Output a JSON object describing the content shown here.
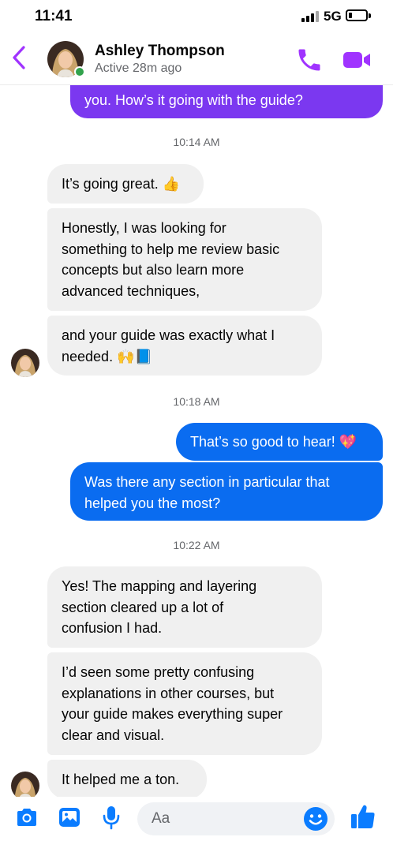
{
  "status_bar": {
    "time": "11:41",
    "network": "5G",
    "battery_level": 0.2
  },
  "header": {
    "contact_name": "Ashley Thompson",
    "contact_status": "Active 28m ago",
    "online": true,
    "back_icon": "chevron-left-icon",
    "call_icon": "phone-icon",
    "video_icon": "video-camera-icon"
  },
  "colors": {
    "accent": "#a033ff",
    "outgoing_purple": "#7b38f0",
    "outgoing_blue": "#0a6cf0",
    "incoming_bg": "#f0f0f0",
    "online_dot": "#31a24c"
  },
  "messages": {
    "m0": "you. How’s it going with the guide?",
    "ts1": "10:14 AM",
    "m1": "It’s going great. 👍",
    "m2_lines": [
      "Honestly, I was looking for",
      "something to help me review basic",
      "concepts but also learn more",
      "advanced techniques,"
    ],
    "m3_lines": [
      "and your guide was exactly what I",
      "needed. 🙌📘"
    ],
    "ts2": "10:18 AM",
    "m4": "That’s so good to hear! 💖",
    "m5_lines": [
      "Was there any section in particular that",
      "helped you the most?"
    ],
    "ts3": "10:22 AM",
    "m6_lines": [
      "Yes! The mapping and layering",
      "section cleared up a lot of",
      "confusion I had."
    ],
    "m7_lines": [
      "I’d seen some pretty confusing",
      "explanations in other courses, but",
      "your guide makes everything super",
      "clear and visual."
    ],
    "m8": "It helped me a ton."
  },
  "composer": {
    "placeholder": "Aa",
    "value": "",
    "icons": [
      "camera-icon",
      "image-icon",
      "microphone-icon",
      "smiley-icon",
      "thumbs-up-icon"
    ]
  }
}
